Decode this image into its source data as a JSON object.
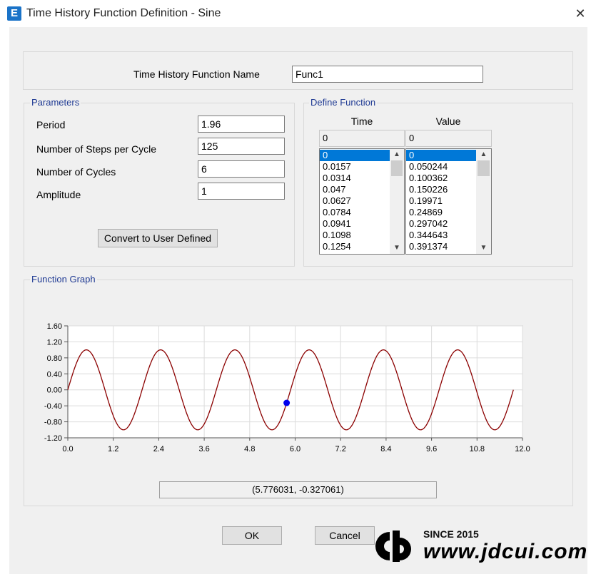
{
  "window": {
    "title": "Time History Function Definition  - Sine",
    "app_icon_letter": "E",
    "close_glyph": "✕"
  },
  "name_row": {
    "label": "Time History Function Name",
    "value": "Func1"
  },
  "parameters": {
    "title": "Parameters",
    "fields": [
      {
        "label": "Period",
        "value": "1.96"
      },
      {
        "label": "Number of Steps per Cycle",
        "value": "125"
      },
      {
        "label": "Number of Cycles",
        "value": "6"
      },
      {
        "label": "Amplitude",
        "value": "1"
      }
    ],
    "convert_label": "Convert to User Defined"
  },
  "define_function": {
    "title": "Define Function",
    "time_header": "Time",
    "value_header": "Value",
    "time_edit": "0",
    "value_edit": "0",
    "time_list": [
      "0",
      "0.0157",
      "0.0314",
      "0.047",
      "0.0627",
      "0.0784",
      "0.0941",
      "0.1098",
      "0.1254"
    ],
    "value_list": [
      "0",
      "0.050244",
      "0.100362",
      "0.150226",
      "0.19971",
      "0.24869",
      "0.297042",
      "0.344643",
      "0.391374"
    ]
  },
  "function_graph": {
    "title": "Function Graph",
    "readout": "(5.776031, -0.327061)"
  },
  "chart_data": {
    "type": "line",
    "function": "sine",
    "period": 1.96,
    "amplitude": 1,
    "cycles": 6,
    "x_range": [
      0,
      11.76
    ],
    "xlim": [
      0,
      12
    ],
    "ylim": [
      -1.2,
      1.6
    ],
    "xticks": [
      "0.0",
      "1.2",
      "2.4",
      "3.6",
      "4.8",
      "6.0",
      "7.2",
      "8.4",
      "9.6",
      "10.8",
      "12.0"
    ],
    "yticks": [
      "1.60",
      "1.20",
      "0.80",
      "0.40",
      "0.00",
      "-0.40",
      "-0.80",
      "-1.20"
    ],
    "xtick_values": [
      0,
      1.2,
      2.4,
      3.6,
      4.8,
      6.0,
      7.2,
      8.4,
      9.6,
      10.8,
      12.0
    ],
    "ytick_values": [
      1.6,
      1.2,
      0.8,
      0.4,
      0.0,
      -0.4,
      -0.8,
      -1.2
    ],
    "marker": {
      "x": 5.776031,
      "y": -0.327061
    },
    "grid": true,
    "line_color": "#8b0000",
    "marker_color": "#0000ee"
  },
  "buttons": {
    "ok": "OK",
    "cancel": "Cancel"
  },
  "watermark": {
    "since": "SINCE 2015",
    "url": "www.jdcui.com"
  }
}
